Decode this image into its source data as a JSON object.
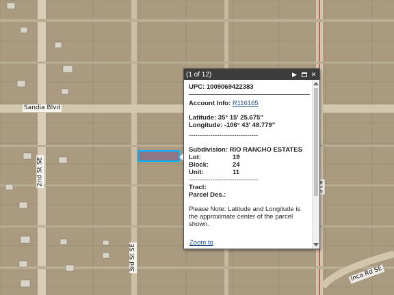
{
  "streets": {
    "sandia": "Sandia Blvd",
    "second": "2nd St SE",
    "third": "3rd St SE",
    "inca": "Inca Rd SE",
    "partial_right": "a t 8"
  },
  "popup": {
    "count": "(1 of 12)",
    "upc_label": "UPC:",
    "upc_value": "1009069422383",
    "account_label": "Account Info:",
    "account_value": "R116165",
    "latitude_label": "Latitude:",
    "latitude_value": "35° 15' 25.675\"",
    "longitude_label": "Longitude:",
    "longitude_value": "-106° 43' 48.779\"",
    "dashes1": "--------------------------------",
    "subdivision_label": "Subdivision:",
    "subdivision_value": "RIO RANCHO ESTATES",
    "lot_label": "Lot:",
    "lot_value": "19",
    "block_label": "Block:",
    "block_value": "24",
    "unit_label": "Unit:",
    "unit_value": "11",
    "dashes2": "--------------------------------",
    "tract_label": "Tract:",
    "parcel_des_label": "Parcel Des.:",
    "note": "Please Note: Latitude and Longitude is the approximate center of the parcel shown.",
    "zoom_link": "Zoom to",
    "icons": [
      "play-icon",
      "maximize-icon",
      "close-icon"
    ]
  },
  "colors": {
    "parcel_outline": "#00b4ff",
    "road": "#d8cdb6",
    "terrain": "#a99a80"
  }
}
